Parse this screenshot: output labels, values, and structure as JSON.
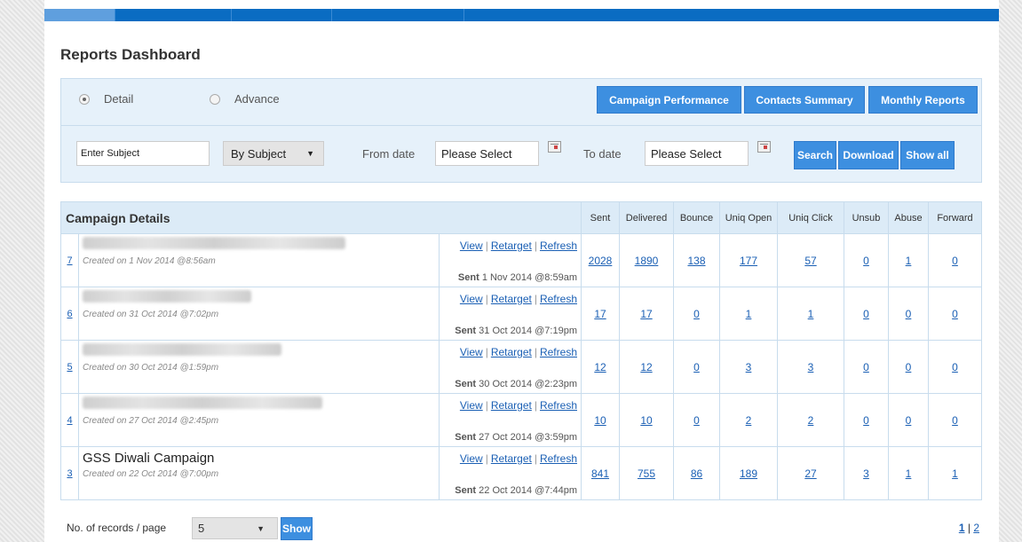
{
  "page": {
    "title": "Reports Dashboard"
  },
  "filter": {
    "mode_detail": "Detail",
    "mode_advance": "Advance",
    "buttons": {
      "campaign_performance": "Campaign Performance",
      "contacts_summary": "Contacts Summary",
      "monthly_reports": "Monthly Reports",
      "search": "Search",
      "download": "Download",
      "show_all": "Show all"
    },
    "subject_placeholder": "Enter Subject",
    "by_select": "By Subject",
    "from_label": "From date",
    "from_value": "Please Select",
    "to_label": "To date",
    "to_value": "Please Select"
  },
  "table": {
    "title": "Campaign Details",
    "columns": [
      "Sent",
      "Delivered",
      "Bounce",
      "Uniq Open",
      "Uniq Click",
      "Unsub",
      "Abuse",
      "Forward"
    ],
    "action_labels": {
      "view": "View",
      "retarget": "Retarget",
      "refresh": "Refresh",
      "sep": "|"
    },
    "sent_prefix": "Sent",
    "rows": [
      {
        "id": "7",
        "name": "",
        "created": "Created on 1 Nov 2014 @8:56am",
        "sent": "1 Nov 2014 @8:59am",
        "stats": [
          "2028",
          "1890",
          "138",
          "177",
          "57",
          "0",
          "1",
          "0"
        ]
      },
      {
        "id": "6",
        "name": "",
        "created": "Created on 31 Oct 2014 @7:02pm",
        "sent": "31 Oct 2014 @7:19pm",
        "stats": [
          "17",
          "17",
          "0",
          "1",
          "1",
          "0",
          "0",
          "0"
        ]
      },
      {
        "id": "5",
        "name": "",
        "created": "Created on 30 Oct 2014 @1:59pm",
        "sent": "30 Oct 2014 @2:23pm",
        "stats": [
          "12",
          "12",
          "0",
          "3",
          "3",
          "0",
          "0",
          "0"
        ]
      },
      {
        "id": "4",
        "name": "",
        "created": "Created on 27 Oct 2014 @2:45pm",
        "sent": "27 Oct 2014 @3:59pm",
        "stats": [
          "10",
          "10",
          "0",
          "2",
          "2",
          "0",
          "0",
          "0"
        ]
      },
      {
        "id": "3",
        "name": "GSS Diwali Campaign",
        "created": "Created on 22 Oct 2014 @7:00pm",
        "sent": "22 Oct 2014 @7:44pm",
        "stats": [
          "841",
          "755",
          "86",
          "189",
          "27",
          "3",
          "1",
          "1"
        ]
      }
    ]
  },
  "footer": {
    "per_page_label": "No. of records / page",
    "per_page_value": "5",
    "show_button": "Show",
    "pages": [
      "1",
      "2"
    ],
    "page_sep": "|"
  }
}
